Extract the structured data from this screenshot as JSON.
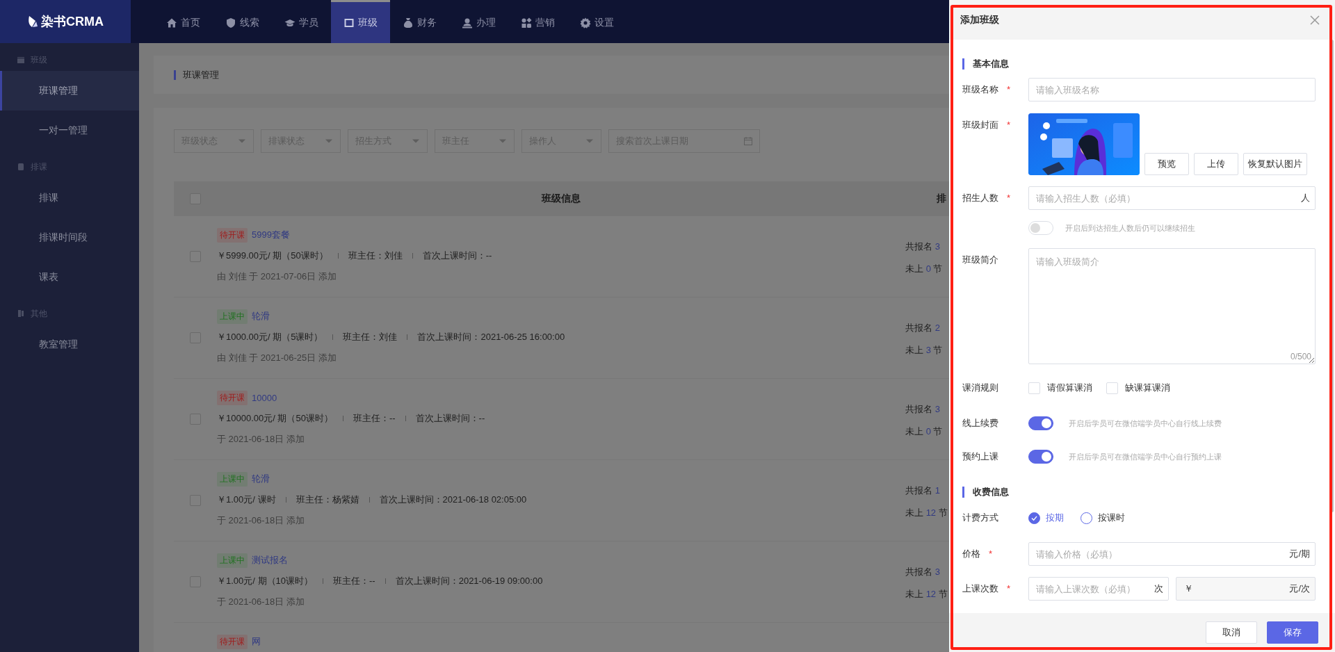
{
  "app": {
    "logo": "染书CRMA"
  },
  "nav": [
    {
      "label": "首页",
      "selected": false
    },
    {
      "label": "线索",
      "selected": false
    },
    {
      "label": "学员",
      "selected": false
    },
    {
      "label": "班级",
      "selected": true
    },
    {
      "label": "财务",
      "selected": false
    },
    {
      "label": "办理",
      "selected": false
    },
    {
      "label": "营销",
      "selected": false
    },
    {
      "label": "设置",
      "selected": false
    }
  ],
  "sidebar": {
    "groups": [
      {
        "title": "班级",
        "items": [
          {
            "label": "班课管理",
            "selected": true
          },
          {
            "label": "一对一管理",
            "selected": false
          }
        ]
      },
      {
        "title": "排课",
        "items": [
          {
            "label": "排课",
            "selected": false
          },
          {
            "label": "排课时间段",
            "selected": false
          },
          {
            "label": "课表",
            "selected": false
          }
        ]
      },
      {
        "title": "其他",
        "items": [
          {
            "label": "教室管理",
            "selected": false
          }
        ]
      }
    ]
  },
  "breadcrumb": "班课管理",
  "filters": [
    {
      "kind": "select",
      "placeholder": "班级状态"
    },
    {
      "kind": "select",
      "placeholder": "排课状态"
    },
    {
      "kind": "select",
      "placeholder": "招生方式"
    },
    {
      "kind": "select",
      "placeholder": "班主任"
    },
    {
      "kind": "select",
      "placeholder": "操作人"
    },
    {
      "kind": "date",
      "placeholder": "搜索首次上课日期"
    }
  ],
  "table": {
    "header_checked": false,
    "columns": [
      "班级信息",
      "排"
    ],
    "rows": [
      {
        "checked": false,
        "status": "待开课",
        "color": "#a01818",
        "name": "5999套餐",
        "price": "￥5999.00元/ 期（50课时）",
        "teacher": "班主任：刘佳",
        "first_class": "首次上课时间：--",
        "added": "由 刘佳 于 2021-07-06日 添加",
        "signup_label": "共报名",
        "signup_count": "3",
        "remaining_label": "未上",
        "remaining_count": "0",
        "remaining_unit": "节"
      },
      {
        "checked": false,
        "status": "上课中",
        "color": "#1e701e",
        "name": "轮滑",
        "price": "￥1000.00元/ 期（5课时）",
        "teacher": "班主任：刘佳",
        "first_class": "首次上课时间：2021-06-25 16:00:00",
        "added": "由 刘佳 于 2021-06-25日 添加",
        "signup_label": "共报名",
        "signup_count": "2",
        "remaining_label": "未上",
        "remaining_count": "3",
        "remaining_unit": "节"
      },
      {
        "checked": false,
        "status": "待开课",
        "color": "#a01818",
        "name": "10000",
        "price": "￥10000.00元/ 期（50课时）",
        "teacher": "班主任：--",
        "first_class": "首次上课时间：--",
        "added": "于 2021-06-18日 添加",
        "signup_label": "共报名",
        "signup_count": "3",
        "remaining_label": "未上",
        "remaining_count": "0",
        "remaining_unit": "节"
      },
      {
        "checked": false,
        "status": "上课中",
        "color": "#1e701e",
        "name": "轮滑",
        "price": "￥1.00元/ 课时",
        "teacher": "班主任：杨紫婧",
        "first_class": "首次上课时间：2021-06-18 02:05:00",
        "added": "于 2021-06-18日 添加",
        "signup_label": "共报名",
        "signup_count": "1",
        "remaining_label": "未上",
        "remaining_count": "12",
        "remaining_unit": "节"
      },
      {
        "checked": false,
        "status": "上课中",
        "color": "#1e701e",
        "name": "测试报名",
        "price": "￥1.00元/ 期（10课时）",
        "teacher": "班主任：--",
        "first_class": "首次上课时间：2021-06-19 09:00:00",
        "added": "于 2021-06-18日 添加",
        "signup_label": "共报名",
        "signup_count": "3",
        "remaining_label": "未上",
        "remaining_count": "12",
        "remaining_unit": "节"
      },
      {
        "status": "待开课",
        "color": "#a01818",
        "name": "网"
      }
    ]
  },
  "drawer": {
    "title": "添加班级",
    "rows": [
      {
        "kind": "section",
        "title": "基本信息"
      },
      {
        "kind": "input",
        "label": "班级名称",
        "required_mark": "*",
        "placeholder": "请输入班级名称"
      },
      {
        "kind": "cover",
        "label": "班级封面",
        "required_mark": "*",
        "buttons": [
          "预览",
          "上传",
          "恢复默认图片"
        ]
      },
      {
        "kind": "input",
        "label": "招生人数",
        "required_mark": "*",
        "placeholder": "请输入招生人数（必填）",
        "suffix": "人"
      },
      {
        "kind": "switch",
        "on": false,
        "hint": "开启后到达招生人数后仍可以继续招生"
      },
      {
        "kind": "textarea",
        "label": "班级简介",
        "placeholder": "请输入班级简介",
        "counter": "0/500"
      },
      {
        "kind": "checkboxes",
        "label": "课消规则",
        "options": [
          {
            "label": "请假算课消",
            "checked": false
          },
          {
            "label": "缺课算课消",
            "checked": false
          }
        ]
      },
      {
        "kind": "switch",
        "label": "线上续费",
        "on": true,
        "hint": "开启后学员可在微信端学员中心自行线上续费"
      },
      {
        "kind": "switch",
        "label": "预约上课",
        "on": true,
        "hint": "开启后学员可在微信端学员中心自行预约上课"
      },
      {
        "kind": "section",
        "title": "收费信息"
      },
      {
        "kind": "radios",
        "label": "计费方式",
        "options": [
          {
            "label": "按期",
            "selected": true
          },
          {
            "label": "按课时",
            "selected": false
          }
        ]
      },
      {
        "kind": "input",
        "label": "价格",
        "required_mark": "*",
        "placeholder": "请输入价格（必填）",
        "suffix": "元/期"
      },
      {
        "kind": "split",
        "label": "上课次数",
        "required_mark": "*",
        "placeholder": "请输入上课次数（必填）",
        "suffix": "次",
        "prefix2": "￥",
        "suffix2": "元/次"
      }
    ],
    "buttons": [
      {
        "label": "取消",
        "kind": "default"
      },
      {
        "label": "保存",
        "kind": "primary"
      }
    ]
  }
}
